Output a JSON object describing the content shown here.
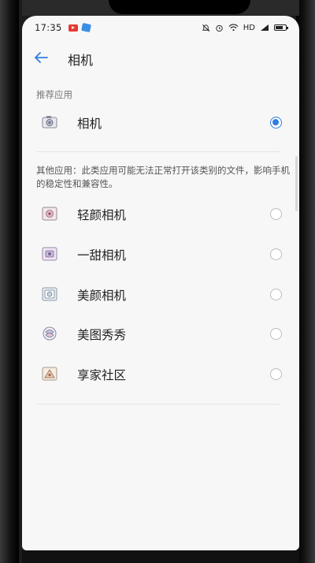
{
  "status_bar": {
    "time": "17:35",
    "hd_label": "HD",
    "battery_level": 0.75
  },
  "header": {
    "title": "相机"
  },
  "recommended": {
    "section_label": "推荐应用",
    "item": {
      "label": "相机",
      "icon": "camera-app-icon",
      "selected": true
    }
  },
  "others": {
    "warning": "其他应用：此类应用可能无法正常打开该类别的文件，影响手机的稳定性和兼容性。",
    "items": [
      {
        "label": "轻颜相机",
        "icon": "qingyan-camera-icon",
        "selected": false
      },
      {
        "label": "一甜相机",
        "icon": "yitian-camera-icon",
        "selected": false
      },
      {
        "label": "美颜相机",
        "icon": "meiyan-camera-icon",
        "selected": false
      },
      {
        "label": "美图秀秀",
        "icon": "meitu-icon",
        "selected": false
      },
      {
        "label": "享家社区",
        "icon": "xiangjia-community-icon",
        "selected": false
      }
    ]
  },
  "colors": {
    "accent": "#2f7de1",
    "background": "#f7f7f7"
  }
}
